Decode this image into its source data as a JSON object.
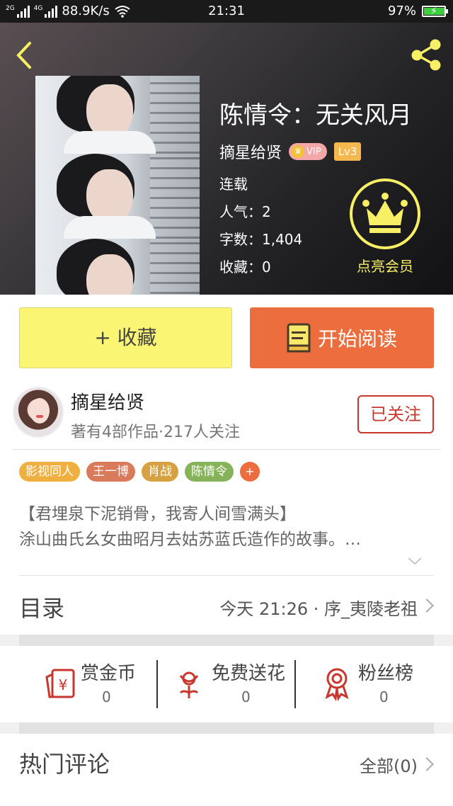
{
  "status_bar": {
    "network_1": "2G",
    "network_2": "4G",
    "speed": "88.9K/s",
    "time": "21:31",
    "battery": "97%",
    "battery_level": 0.97
  },
  "header": {
    "back_icon": "chevron-left-icon",
    "share_icon": "share-icon",
    "book_title": "陈情令：无关风月",
    "author": "摘星给贤",
    "vip_label": "VIP",
    "level": "Lv3",
    "status": "连载",
    "popularity": "人气：2",
    "word_count": "字数：1,404",
    "favorites": "收藏：0",
    "member_label": "点亮会员",
    "accent_color": "#f7ef66"
  },
  "actions": {
    "favorite_label": "+ 收藏",
    "read_label": "开始阅读",
    "favorite_color": "#fbf574",
    "read_color": "#ec6d3d"
  },
  "author_block": {
    "name": "摘星给贤",
    "stats": "著有4部作品·217人关注",
    "follow_label": "已关注",
    "tags": [
      {
        "label": "影视同人",
        "color": "#efb040"
      },
      {
        "label": "王一博",
        "color": "#d97a5a"
      },
      {
        "label": "肖战",
        "color": "#d7a040"
      },
      {
        "label": "陈情令",
        "color": "#86b35a"
      }
    ],
    "tag_add": "+",
    "synopsis_line1": "【君埋泉下泥销骨，我寄人间雪满头】",
    "synopsis_line2": "涂山曲氏幺女曲昭月去姑苏蓝氏造作的故事。…"
  },
  "catalog": {
    "title": "目录",
    "latest": "今天 21:26 · 序_夷陵老祖"
  },
  "rewards": [
    {
      "label": "赏金币",
      "value": "0",
      "icon": "red-envelope-yen-icon"
    },
    {
      "label": "免费送花",
      "value": "0",
      "icon": "flower-icon"
    },
    {
      "label": "粉丝榜",
      "value": "0",
      "icon": "award-ribbon-icon"
    }
  ],
  "comments": {
    "title": "热门评论",
    "all_label": "全部(0)"
  }
}
